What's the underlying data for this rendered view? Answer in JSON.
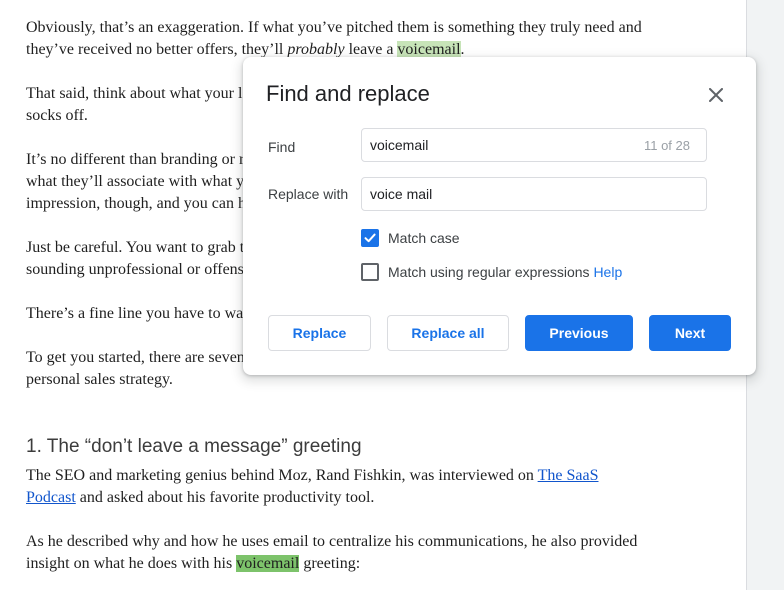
{
  "document": {
    "p1_line1": "Obviously, that’s an exaggeration. If what you’ve pitched them is something they truly need and",
    "p1_line2_before": "they’ve received no better offers, they’ll ",
    "p1_line2_italic": "probably",
    "p1_line2_mid": " leave a ",
    "p1_line2_match": "voicemail",
    "p1_line2_after": ".",
    "p2_line1": "That said, think about what your l",
    "p2_line2": "socks off.",
    "p3_line1": "It’s no different than branding or r",
    "p3_line2": "what they’ll associate with what y",
    "p3_line3": "impression, though, and you can h",
    "p4_line1": "Just be careful. You want to grab t",
    "p4_line2": "sounding unprofessional or offens",
    "p5_line1": "There’s a fine line you have to wa",
    "p6_line1": "To get you started, there are seven",
    "p6_line2": "personal sales strategy.",
    "heading": "1. The “don’t leave a message” greeting",
    "p7_line1_before": "The SEO and marketing genius behind Moz, Rand Fishkin, was interviewed on ",
    "p7_link_part1": "The SaaS",
    "p7_link_part2": "Podcast",
    "p7_line2_after": " and asked about his favorite productivity tool.",
    "p8_line1": "As he described why and how he uses email to centralize his communications, he also provided",
    "p8_line2_before": "insight on what he does with his ",
    "p8_line2_match": "voicemail",
    "p8_line2_after": " greeting:"
  },
  "dialog": {
    "title": "Find and replace",
    "find_label": "Find",
    "find_value": "voicemail",
    "find_count": "11 of 28",
    "replace_label": "Replace with",
    "replace_value": "voice mail",
    "match_case_label": "Match case",
    "match_case_checked": true,
    "regex_label": "Match using regular expressions",
    "regex_checked": false,
    "help_label": "Help",
    "buttons": {
      "replace": "Replace",
      "replace_all": "Replace all",
      "previous": "Previous",
      "next": "Next"
    }
  },
  "colors": {
    "accent": "#1a73e8",
    "current_match_highlight": "#7dc36b",
    "other_match_highlight": "#c7e4b8"
  },
  "icons": {
    "close": "close-icon",
    "checkmark": "checkmark-icon"
  }
}
